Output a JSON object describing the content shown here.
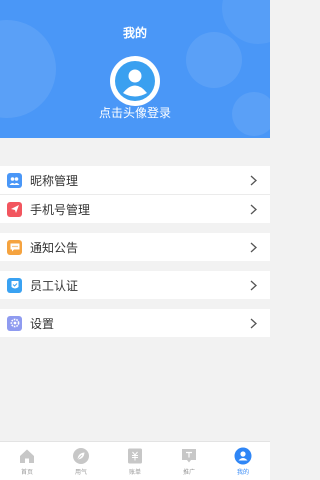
{
  "header": {
    "title": "我的",
    "login_prompt": "点击头像登录",
    "accent_color": "#4a97f7"
  },
  "menu": [
    {
      "label": "昵称管理",
      "icon": "contacts-icon",
      "icon_color": "#4a97f7"
    },
    {
      "label": "手机号管理",
      "icon": "send-icon",
      "icon_color": "#f2565f"
    },
    {
      "label": "通知公告",
      "icon": "message-icon",
      "icon_color": "#f5a33f"
    },
    {
      "label": "员工认证",
      "icon": "verify-icon",
      "icon_color": "#3aa2f2"
    },
    {
      "label": "设置",
      "icon": "gear-icon",
      "icon_color": "#8f9bf0"
    }
  ],
  "tabbar": {
    "tabs": [
      {
        "label": "首页",
        "icon": "home-icon",
        "active": false
      },
      {
        "label": "用气",
        "icon": "leaf-icon",
        "active": false
      },
      {
        "label": "账单",
        "icon": "bill-icon",
        "active": false
      },
      {
        "label": "推广",
        "icon": "promote-icon",
        "active": false
      },
      {
        "label": "我的",
        "icon": "user-icon",
        "active": true
      }
    ],
    "active_color": "#2f86f6",
    "inactive_color": "#999999"
  }
}
